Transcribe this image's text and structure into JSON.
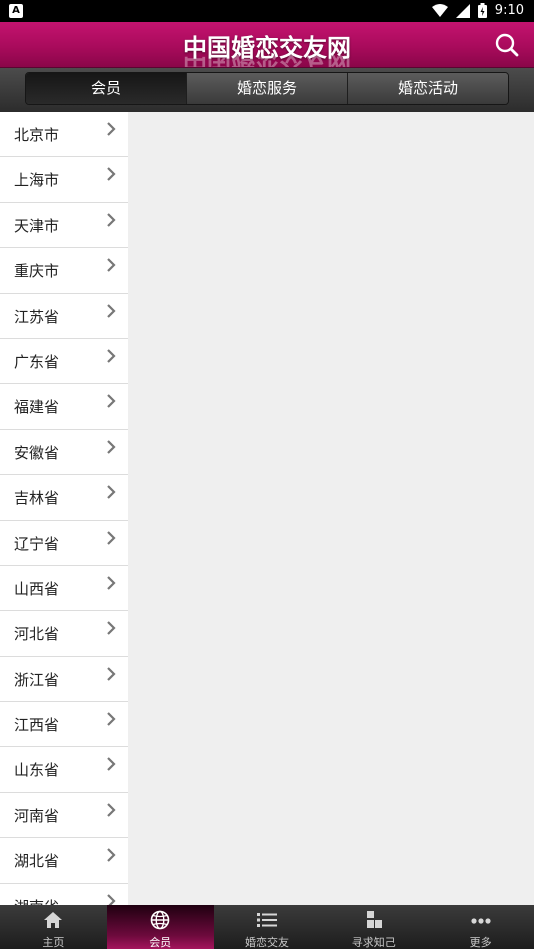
{
  "status_bar": {
    "notification_badge": "A",
    "time": "9:10",
    "icons": [
      "wifi-icon",
      "signal-icon",
      "battery-icon"
    ]
  },
  "header": {
    "title": "中国婚恋交友网",
    "search_icon": "search-icon",
    "accent_color": "#b10d61"
  },
  "tabs": [
    {
      "label": "会员",
      "active": true
    },
    {
      "label": "婚恋服务",
      "active": false
    },
    {
      "label": "婚恋活动",
      "active": false
    }
  ],
  "provinces": [
    "北京市",
    "上海市",
    "天津市",
    "重庆市",
    "江苏省",
    "广东省",
    "福建省",
    "安徽省",
    "吉林省",
    "辽宁省",
    "山西省",
    "河北省",
    "浙江省",
    "江西省",
    "山东省",
    "河南省",
    "湖北省",
    "湖南省"
  ],
  "bottom_nav": [
    {
      "label": "主页",
      "icon": "home-icon",
      "active": false
    },
    {
      "label": "会员",
      "icon": "globe-icon",
      "active": true
    },
    {
      "label": "婚恋交友",
      "icon": "list-icon",
      "active": false
    },
    {
      "label": "寻求知己",
      "icon": "blocks-icon",
      "active": false
    },
    {
      "label": "更多",
      "icon": "more-icon",
      "active": false
    }
  ]
}
